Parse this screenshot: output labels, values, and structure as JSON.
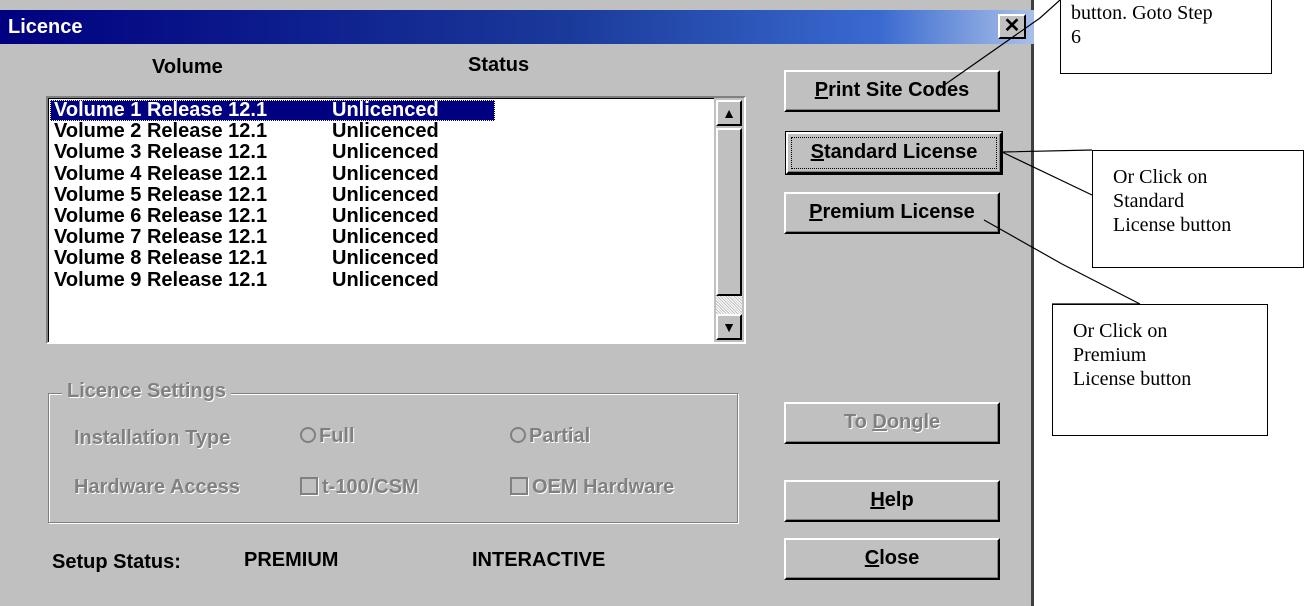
{
  "window": {
    "title": "Licence",
    "close_glyph": "✕"
  },
  "columns": {
    "volume": "Volume",
    "status": "Status"
  },
  "list": {
    "selected_index": 0,
    "items": [
      {
        "volume": "Volume 1 Release 12.1",
        "status": "Unlicenced"
      },
      {
        "volume": "Volume 2 Release 12.1",
        "status": "Unlicenced"
      },
      {
        "volume": "Volume 3 Release 12.1",
        "status": "Unlicenced"
      },
      {
        "volume": "Volume 4 Release 12.1",
        "status": "Unlicenced"
      },
      {
        "volume": "Volume 5 Release 12.1",
        "status": "Unlicenced"
      },
      {
        "volume": "Volume 6 Release 12.1",
        "status": "Unlicenced"
      },
      {
        "volume": "Volume 7 Release 12.1",
        "status": "Unlicenced"
      },
      {
        "volume": "Volume 8 Release 12.1",
        "status": "Unlicenced"
      },
      {
        "volume": "Volume 9 Release 12.1",
        "status": "Unlicenced"
      }
    ]
  },
  "buttons": {
    "print_site_codes": {
      "label": "Print Site Codes",
      "mnemonic": "P",
      "rest": "rint Site Codes"
    },
    "standard_license": {
      "label": "Standard License",
      "mnemonic": "S",
      "rest": "tandard License"
    },
    "premium_license": {
      "label": "Premium License",
      "mnemonic": "P",
      "rest": "remium License"
    },
    "to_dongle": {
      "label": "To Dongle",
      "pre": "To ",
      "mnemonic": "D",
      "rest": "ongle"
    },
    "help": {
      "label": "Help",
      "mnemonic": "H",
      "rest": "elp"
    },
    "close": {
      "label": "Close",
      "mnemonic": "C",
      "rest": "lose"
    }
  },
  "licence_settings": {
    "group_label": "Licence Settings",
    "installation_type_label": "Installation Type",
    "radio_full": "Full",
    "radio_partial": "Partial",
    "hardware_access_label": "Hardware Access",
    "check_t100": "t-100/CSM",
    "check_oem": "OEM Hardware"
  },
  "setup_status": {
    "label": "Setup Status:",
    "mode": "PREMIUM",
    "type": "INTERACTIVE"
  },
  "callouts": {
    "top": {
      "line1": "button. Goto Step",
      "line2": "6"
    },
    "standard": {
      "line1": "Or Click on",
      "line2": "Standard",
      "line3": "License button"
    },
    "premium": {
      "line1": "Or Click on",
      "line2": "Premium",
      "line3": "License button"
    }
  }
}
